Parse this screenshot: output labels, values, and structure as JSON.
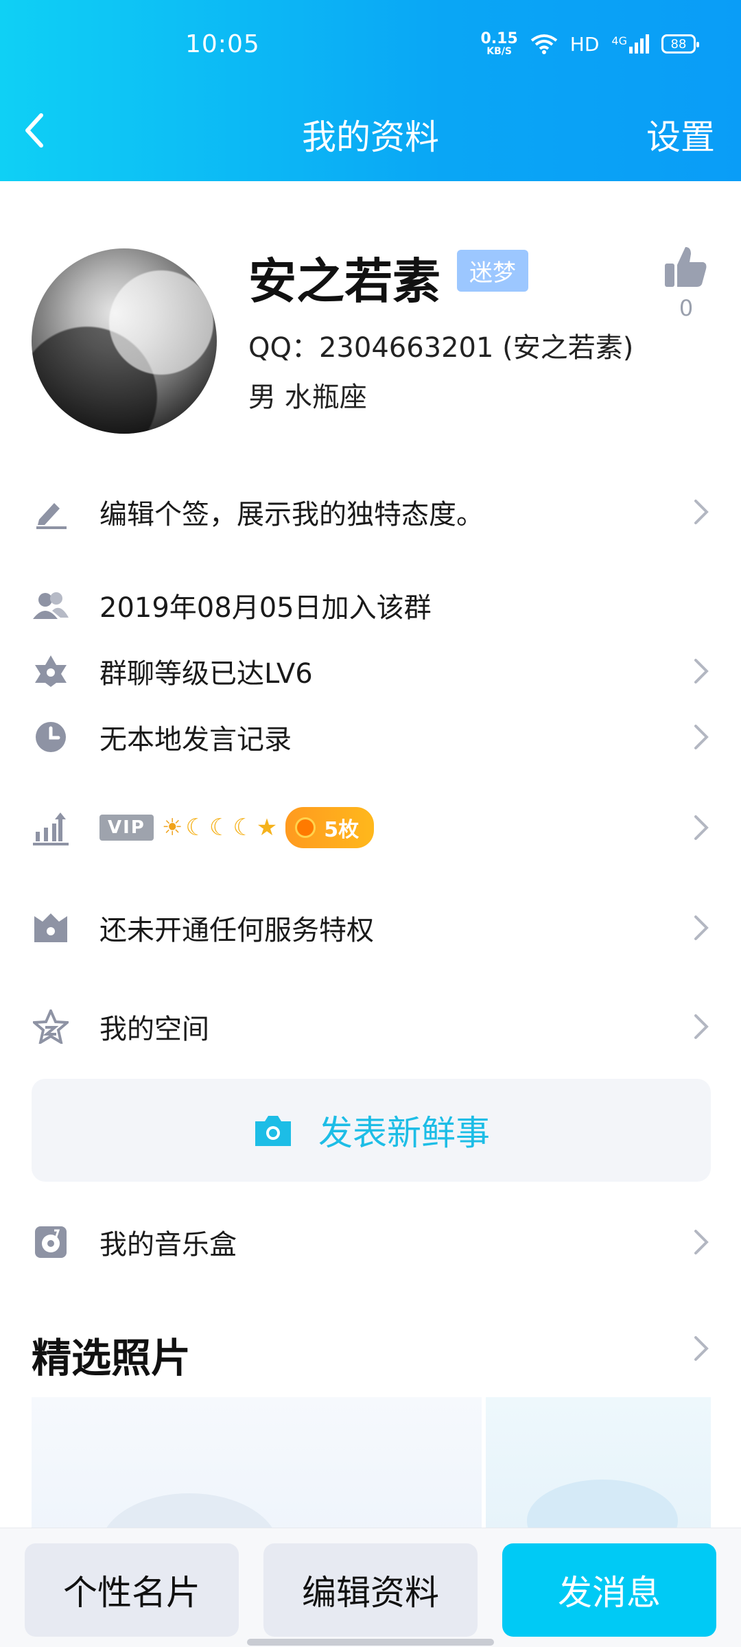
{
  "status": {
    "time": "10:05",
    "net_speed_value": "0.15",
    "net_speed_unit": "KB/S",
    "hd": "HD",
    "signal_label": "4G",
    "battery": "88"
  },
  "nav": {
    "title": "我的资料",
    "settings_label": "设置"
  },
  "profile": {
    "name": "安之若素",
    "tag": "迷梦",
    "likes": "0",
    "qq_line": "QQ：2304663201 (安之若素)",
    "gender_line": "男  水瓶座"
  },
  "rows": {
    "signature": "编辑个签，展示我的独特态度。",
    "join_date": "2019年08月05日加入该群",
    "group_level": "群聊等级已达LV6",
    "speech": "无本地发言记录",
    "vip_label": "VIP",
    "coin_label": "5枚",
    "privilege": "还未开通任何服务特权",
    "space": "我的空间",
    "music": "我的音乐盒"
  },
  "post": {
    "label": "发表新鲜事"
  },
  "photos": {
    "title": "精选照片"
  },
  "bottom": {
    "card": "个性名片",
    "edit": "编辑资料",
    "message": "发消息"
  },
  "colors": {
    "header_start": "#0fd0f5",
    "header_end": "#0a9df7",
    "accent": "#00caf5",
    "post_text": "#1dbde6",
    "tag_bg": "#9cc7ff",
    "icon_gray": "#8e93a4"
  }
}
